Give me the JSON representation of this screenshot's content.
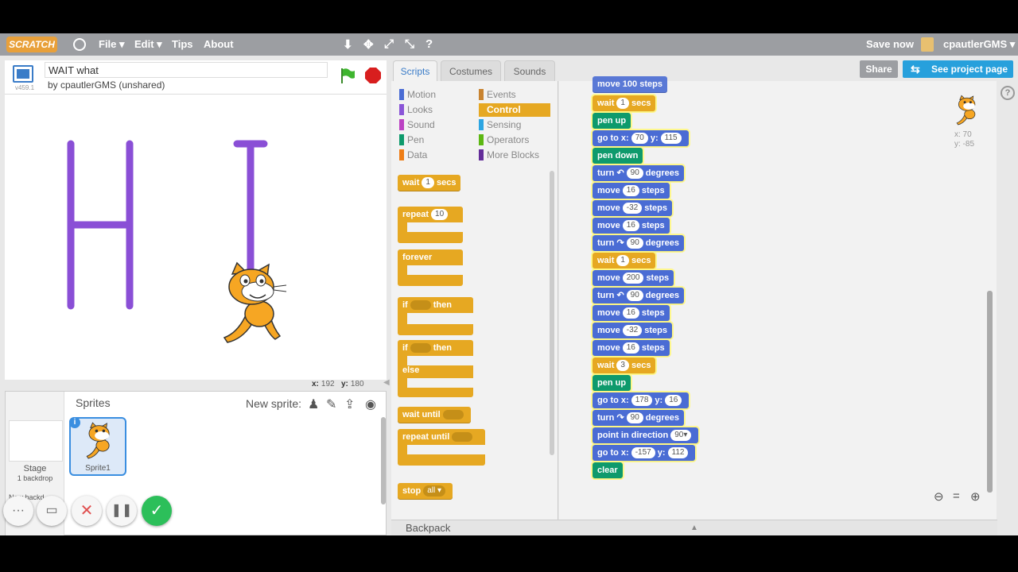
{
  "menubar": {
    "logo": "SCRATCH",
    "items": [
      "File ▾",
      "Edit ▾",
      "Tips",
      "About"
    ],
    "save": "Save now",
    "user": "cpautlerGMS ▾"
  },
  "project": {
    "title": "WAIT what",
    "byline": "by cpautlerGMS (unshared)",
    "version": "v459.1"
  },
  "stage": {
    "x_label": "x:",
    "x_value": "192",
    "y_label": "y:",
    "y_value": "180"
  },
  "sprites": {
    "title": "Sprites",
    "new_sprite": "New sprite:",
    "stage_label": "Stage",
    "backdrop_count": "1 backdrop",
    "new_backdrop": "New backd",
    "sprite_name": "Sprite1"
  },
  "tabs": [
    "Scripts",
    "Costumes",
    "Sounds"
  ],
  "buttons": {
    "share": "Share",
    "see_project": "See project page"
  },
  "categories": {
    "left": [
      {
        "label": "Motion",
        "color": "#4a6cd4"
      },
      {
        "label": "Looks",
        "color": "#8a55d7"
      },
      {
        "label": "Sound",
        "color": "#bb42c3"
      },
      {
        "label": "Pen",
        "color": "#0e9a6c"
      },
      {
        "label": "Data",
        "color": "#ee7d16"
      }
    ],
    "right": [
      {
        "label": "Events",
        "color": "#c88330"
      },
      {
        "label": "Control",
        "color": "#e6a822"
      },
      {
        "label": "Sensing",
        "color": "#2ca5e2"
      },
      {
        "label": "Operators",
        "color": "#5cb712"
      },
      {
        "label": "More Blocks",
        "color": "#632d99"
      }
    ]
  },
  "palette": {
    "wait": "wait",
    "wait_val": "1",
    "wait_unit": "secs",
    "repeat": "repeat",
    "repeat_val": "10",
    "forever": "forever",
    "if": "if",
    "then": "then",
    "then2": "then",
    "if2": "if",
    "else": "else",
    "wait_until": "wait until",
    "repeat_until": "repeat until",
    "stop": "stop",
    "stop_val": "all ▾"
  },
  "script": {
    "top_partial": "move 100 steps",
    "blocks": [
      {
        "kind": "ctl",
        "parts": [
          "wait",
          "#1",
          "secs"
        ]
      },
      {
        "kind": "pen",
        "parts": [
          "pen up"
        ]
      },
      {
        "kind": "mot",
        "parts": [
          "go to x:",
          "#70",
          "y:",
          "#115"
        ]
      },
      {
        "kind": "pen",
        "parts": [
          "pen down"
        ]
      },
      {
        "kind": "mot",
        "parts": [
          "turn ↶",
          "#90",
          "degrees"
        ]
      },
      {
        "kind": "mot",
        "parts": [
          "move",
          "#16",
          "steps"
        ]
      },
      {
        "kind": "mot",
        "parts": [
          "move",
          "#-32",
          "steps"
        ]
      },
      {
        "kind": "mot",
        "parts": [
          "move",
          "#16",
          "steps"
        ]
      },
      {
        "kind": "mot",
        "parts": [
          "turn ↷",
          "#90",
          "degrees"
        ]
      },
      {
        "kind": "ctl",
        "parts": [
          "wait",
          "#1",
          "secs"
        ]
      },
      {
        "kind": "mot",
        "parts": [
          "move",
          "#200",
          "steps"
        ]
      },
      {
        "kind": "mot",
        "parts": [
          "turn ↶",
          "#90",
          "degrees"
        ]
      },
      {
        "kind": "mot",
        "parts": [
          "move",
          "#16",
          "steps"
        ]
      },
      {
        "kind": "mot",
        "parts": [
          "move",
          "#-32",
          "steps"
        ]
      },
      {
        "kind": "mot",
        "parts": [
          "move",
          "#16",
          "steps"
        ]
      },
      {
        "kind": "ctl",
        "parts": [
          "wait",
          "#3",
          "secs"
        ]
      },
      {
        "kind": "pen",
        "parts": [
          "pen up"
        ]
      },
      {
        "kind": "mot",
        "parts": [
          "go to x:",
          "#178",
          "y:",
          "#16"
        ]
      },
      {
        "kind": "mot",
        "parts": [
          "turn ↷",
          "#90",
          "degrees"
        ]
      },
      {
        "kind": "mot",
        "parts": [
          "point in direction",
          "#90▾"
        ]
      },
      {
        "kind": "mot",
        "parts": [
          "go to x:",
          "#-157",
          "y:",
          "#112"
        ]
      },
      {
        "kind": "pen",
        "parts": [
          "clear"
        ]
      }
    ]
  },
  "sprite_info": {
    "x": "x: 70",
    "y": "y: -85"
  },
  "backpack": "Backpack"
}
